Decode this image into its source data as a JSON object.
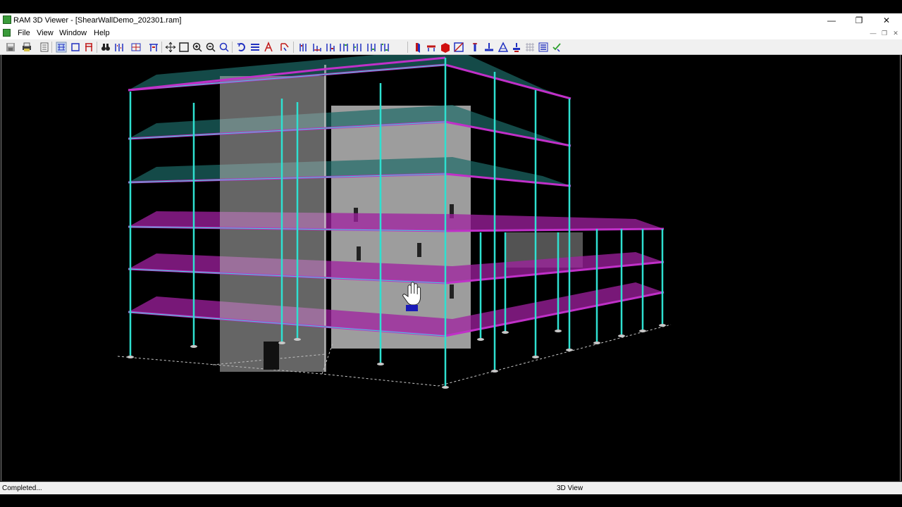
{
  "window": {
    "title": "RAM 3D Viewer - [ShearWallDemo_202301.ram]",
    "controls": {
      "minimize": "—",
      "restore": "❐",
      "close": "✕"
    }
  },
  "menu": {
    "items": [
      {
        "label": "File"
      },
      {
        "label": "View"
      },
      {
        "label": "Window"
      },
      {
        "label": "Help"
      }
    ],
    "mdi_controls": {
      "minimize": "—",
      "restore": "❐",
      "close": "✕"
    }
  },
  "toolbar": {
    "buttons": [
      "save-icon",
      "print-icon",
      "properties-icon",
      "frame-view-icon",
      "box-view-icon",
      "portal-view-icon",
      "find-icon",
      "column-filter-icon",
      "member-filter-icon",
      "frame-filter-icon",
      "pan-icon",
      "zoom-window-icon",
      "zoom-in-icon",
      "zoom-out-icon",
      "rotate-icon",
      "level-icon",
      "frame-label-icon",
      "filter-icon",
      "member-list-1-icon",
      "member-list-2-icon",
      "member-list-3-icon",
      "member-list-4-icon",
      "member-list-5-icon",
      "member-list-6-icon",
      "wall-icon",
      "beam-icon",
      "slab-icon",
      "brace-icon",
      "column-icon",
      "foundation-icon",
      "joist-icon",
      "load-icon",
      "grid-icon",
      "layers-icon",
      "check-icon"
    ]
  },
  "viewport": {
    "view_name": "3D View",
    "cursor": "hand-cursor-icon",
    "colors": {
      "background": "#000000",
      "frame": "#2ee0d0",
      "beam_edge": "#c030c8",
      "slab_upper": "#1c6a66",
      "slab_lower": "#a020a0",
      "wall": "#b8b8b8",
      "ground": "#c8c8c8"
    }
  },
  "status": {
    "left": "Completed...",
    "right": "3D View"
  }
}
